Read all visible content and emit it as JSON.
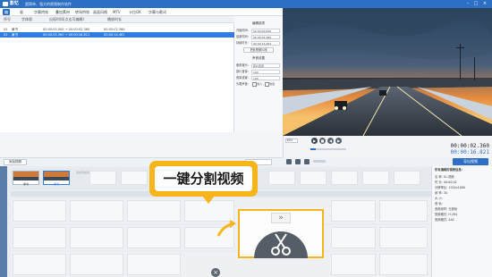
{
  "app": {
    "name": "影忆",
    "slogan": "超简单、强大的视频制作软件",
    "accent": "#2d6fc4",
    "highlight": "#f6b61b"
  },
  "menu": [
    "编",
    "画",
    "字幕特效",
    "叠加素材",
    "转场特效",
    "画面风格",
    "MTV",
    "卡拉OK",
    "字幕与歌词"
  ],
  "menu_active_index": 0,
  "subtitle_table": {
    "headers": [
      "序号",
      "字体版",
      "出现时间(点击可编辑)",
      "播放时长"
    ],
    "rows": [
      {
        "no": "01",
        "font": "隶书",
        "time": "00:00:00.000 → 00:00:02.360",
        "dur": "00:00:02.360",
        "selected": false
      },
      {
        "no": "02",
        "font": "隶书",
        "time": "00:00:02.360 → 00:00:16.821",
        "dur": "00:00:14.461",
        "selected": true
      }
    ]
  },
  "settings": {
    "title1": "编辑选项",
    "rows1": [
      {
        "label": "开始时间:",
        "value": "00:00:00.000"
      },
      {
        "label": "结束时间:",
        "value": "00:00:02.360"
      },
      {
        "label": "持续时长:",
        "value": "00:00:14.461"
      }
    ],
    "button1": "把此视频片段",
    "title2": "声音设置",
    "rows2": [
      {
        "label": "使用音乐:",
        "value": "原片原音"
      },
      {
        "label": "原片音量:",
        "value": "100"
      },
      {
        "label": "音量设置:",
        "value": "100"
      }
    ],
    "effects_label": "头尾声音:",
    "fade_in": "淡入",
    "fade_out": "淡出"
  },
  "player": {
    "current_time": "00:00:02.360",
    "total_time": "00:00:16.821",
    "zoom": "100",
    "export_label": "导出视频"
  },
  "timeline": {
    "add_button": "添加视频",
    "clips": [
      {
        "label": "隶书"
      },
      {
        "label": "隶书"
      }
    ],
    "drop_hint": "双击添加新的视频"
  },
  "properties": {
    "title": "所有编辑的视频信息:",
    "rows": [
      {
        "label": "名  称:",
        "value": "01.视频"
      },
      {
        "label": "时  长:",
        "value": "00:00:02"
      },
      {
        "label": "分辨率比:",
        "value": "1920x1080"
      },
      {
        "label": "帧  率:",
        "value": "30"
      },
      {
        "label": "大  小:",
        "value": ""
      },
      {
        "label": "音  轨:",
        "value": ""
      },
      {
        "label": "音频采样:",
        "value": "无音轨"
      },
      {
        "label": "视频格式:",
        "value": "H.264"
      },
      {
        "label": "音频格式:",
        "value": "AAC"
      }
    ]
  },
  "callout": {
    "text": "一键分割视频"
  },
  "icons": {
    "scissors": "scissors-icon",
    "forward": "double-chevron-icon"
  }
}
